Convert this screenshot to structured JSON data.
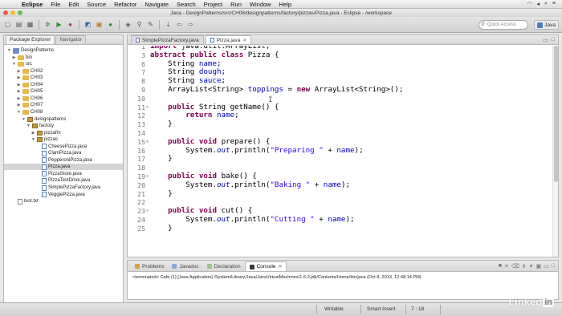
{
  "menubar": {
    "app": "Eclipse",
    "items": [
      "File",
      "Edit",
      "Source",
      "Refactor",
      "Navigate",
      "Search",
      "Project",
      "Run",
      "Window",
      "Help"
    ]
  },
  "window": {
    "title": "Java - DesignPatterns/src/CH08/designpatterns/factory/pizzas/Pizza.java - Eclipse - /workspace"
  },
  "toolbar": {
    "quick_access_placeholder": "Quick Access",
    "perspective_label": "Java"
  },
  "explorer": {
    "tabs": [
      "Package Explorer",
      "Navigator"
    ],
    "nodes": [
      {
        "label": "DesignPatterns",
        "type": "project",
        "expanded": true
      },
      {
        "label": "bin",
        "type": "folder",
        "expanded": false
      },
      {
        "label": "src",
        "type": "folder",
        "expanded": true
      },
      {
        "label": "CH02",
        "type": "folder",
        "expanded": false
      },
      {
        "label": "CH03",
        "type": "folder",
        "expanded": false
      },
      {
        "label": "CH04",
        "type": "folder",
        "expanded": false
      },
      {
        "label": "CH05",
        "type": "folder",
        "expanded": false
      },
      {
        "label": "CH06",
        "type": "folder",
        "expanded": false
      },
      {
        "label": "CH07",
        "type": "folder",
        "expanded": false
      },
      {
        "label": "CH08",
        "type": "folder",
        "expanded": true
      },
      {
        "label": "designpatterns",
        "type": "folder",
        "expanded": true
      },
      {
        "label": "factory",
        "type": "folder",
        "expanded": true
      },
      {
        "label": "pizzafm",
        "type": "folder",
        "expanded": false
      },
      {
        "label": "pizzas",
        "type": "folder",
        "expanded": true
      },
      {
        "label": "CheesePizza.java",
        "type": "java"
      },
      {
        "label": "ClamPizza.java",
        "type": "java"
      },
      {
        "label": "PepperoniPizza.java",
        "type": "java"
      },
      {
        "label": "Pizza.java",
        "type": "java",
        "selected": true
      },
      {
        "label": "PizzaStore.java",
        "type": "java"
      },
      {
        "label": "PizzaTestDrive.java",
        "type": "java"
      },
      {
        "label": "SimplePizzaFactory.java",
        "type": "java"
      },
      {
        "label": "VeggiePizza.java",
        "type": "java"
      },
      {
        "label": "test.txt",
        "type": "text"
      }
    ]
  },
  "editor": {
    "tabs": [
      {
        "label": "SimplePizzaFactory.java",
        "active": false
      },
      {
        "label": "Pizza.java",
        "active": true
      }
    ],
    "lines": [
      {
        "n": "1",
        "text": "import java.util.ArrayList;"
      },
      {
        "n": "3",
        "text": "abstract public class Pizza {"
      },
      {
        "n": "6",
        "text": "    String name;"
      },
      {
        "n": "7",
        "text": "    String dough;"
      },
      {
        "n": "8",
        "text": "    String sauce;"
      },
      {
        "n": "9",
        "text": "    ArrayList<String> toppings = new ArrayList<String>();"
      },
      {
        "n": "10",
        "text": ""
      },
      {
        "n": "11",
        "text": "    public String getName() {"
      },
      {
        "n": "12",
        "text": "        return name;"
      },
      {
        "n": "13",
        "text": "    }"
      },
      {
        "n": "14",
        "text": ""
      },
      {
        "n": "15",
        "text": "    public void prepare() {"
      },
      {
        "n": "16",
        "text": "        System.out.println(\"Preparing \" + name);"
      },
      {
        "n": "17",
        "text": "    }"
      },
      {
        "n": "18",
        "text": ""
      },
      {
        "n": "19",
        "text": "    public void bake() {"
      },
      {
        "n": "20",
        "text": "        System.out.println(\"Baking \" + name);"
      },
      {
        "n": "21",
        "text": "    }"
      },
      {
        "n": "22",
        "text": ""
      },
      {
        "n": "23",
        "text": "    public void cut() {"
      },
      {
        "n": "24",
        "text": "        System.out.println(\"Cutting \" + name);"
      },
      {
        "n": "25",
        "text": "    }"
      }
    ]
  },
  "console": {
    "tabs": [
      "Problems",
      "Javadoc",
      "Declaration",
      "Console"
    ],
    "active_tab": "Console",
    "output": "<terminated> Cafe (1) [Java Application] /System/Library/Java/JavaVirtualMachines/1.6.0.jdk/Contents/Home/bin/java (Oct 8, 2013, 12:48:14 PM)"
  },
  "status": {
    "mode": "Writable",
    "insert": "Smart Insert",
    "position": "7 : 18"
  },
  "watermark": {
    "brand": "Linked",
    "suffix": "in"
  }
}
